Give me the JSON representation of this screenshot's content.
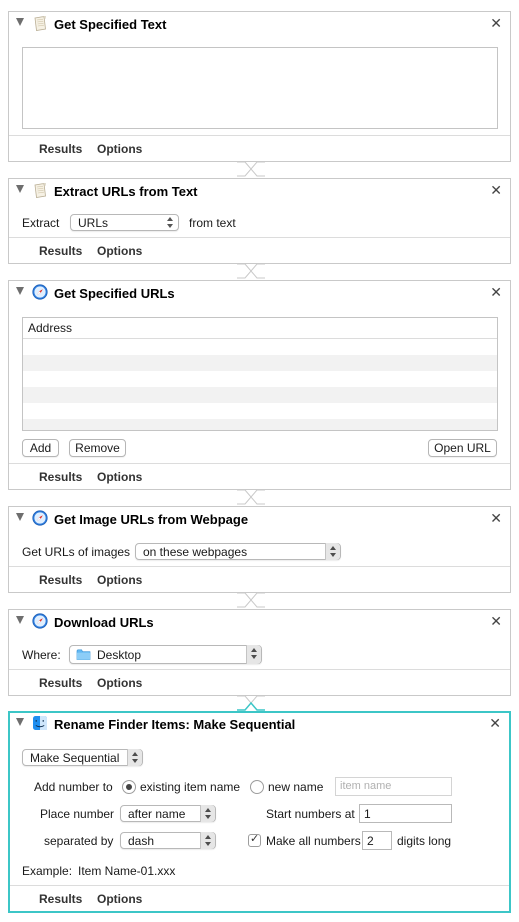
{
  "footer": {
    "results_label": "Results",
    "options_label": "Options"
  },
  "actions": [
    {
      "title": "Get Specified Text",
      "icon": "textedit-icon"
    },
    {
      "title": "Extract URLs from Text",
      "icon": "textedit-icon",
      "extract_label": "Extract",
      "extract_value": "URLs",
      "from_text_label": "from text"
    },
    {
      "title": "Get Specified URLs",
      "icon": "safari-icon",
      "column_header": "Address",
      "add_label": "Add",
      "remove_label": "Remove",
      "open_url_label": "Open URL"
    },
    {
      "title": "Get Image URLs from Webpage",
      "icon": "safari-icon",
      "get_label": "Get URLs of images",
      "get_value": "on these webpages"
    },
    {
      "title": "Download URLs",
      "icon": "safari-icon",
      "where_label": "Where:",
      "where_value": "Desktop"
    },
    {
      "title": "Rename Finder Items: Make Sequential",
      "icon": "finder-icon",
      "mode_value": "Make Sequential",
      "add_number_label": "Add number to",
      "existing_item_label": "existing item name",
      "new_name_label": "new name",
      "item_name_placeholder": "item name",
      "place_number_label": "Place number",
      "place_number_value": "after name",
      "start_numbers_label": "Start numbers at",
      "start_numbers_value": "1",
      "separated_by_label": "separated by",
      "separated_by_value": "dash",
      "make_all_label": "Make all numbers",
      "digits_value": "2",
      "digits_long_label": "digits long",
      "example_label": "Example:",
      "example_value": "Item Name-01.xxx"
    }
  ],
  "colors": {
    "selected_border": "#3cc6c7",
    "panel_border": "#c9c9c9"
  }
}
